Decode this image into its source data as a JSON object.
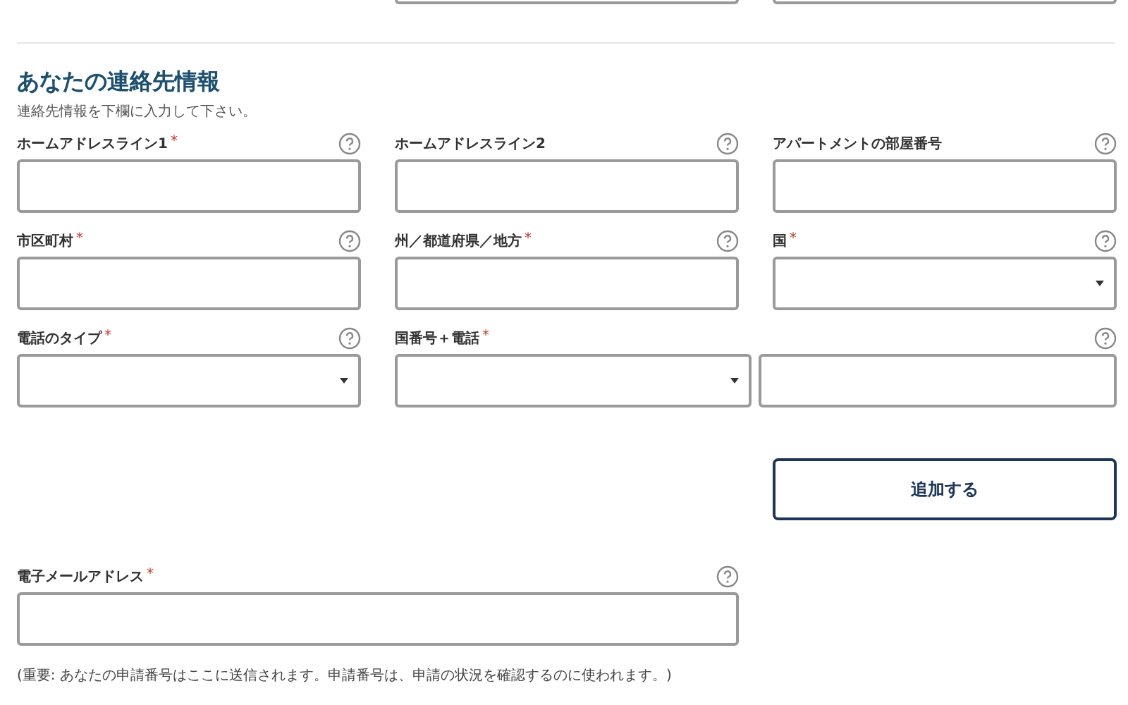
{
  "section": {
    "title": "あなたの連絡先情報",
    "intro": "連絡先情報を下欄に入力して下さい。"
  },
  "fields": [
    {
      "kind": "text",
      "label": "ホームアドレスライン1",
      "required_mark": "*"
    },
    {
      "kind": "text",
      "label": "ホームアドレスライン2"
    },
    {
      "kind": "text",
      "label": "アパートメントの部屋番号"
    },
    {
      "kind": "text",
      "label": "市区町村",
      "required_mark": "*"
    },
    {
      "kind": "text",
      "label": "州／都道府県／地方",
      "required_mark": "*"
    },
    {
      "kind": "select",
      "label": "国",
      "required_mark": "*"
    },
    {
      "kind": "select",
      "label": "電話のタイプ",
      "required_mark": "*"
    },
    {
      "kind": "phone",
      "label": "国番号＋電話",
      "required_mark": "*"
    }
  ],
  "add_button": "追加する",
  "email": {
    "label": "電子メールアドレス",
    "required_mark": "*"
  },
  "note": "(重要: あなたの申請番号はここに送信されます。申請番号は、申請の状況を確認するのに使われます。)"
}
